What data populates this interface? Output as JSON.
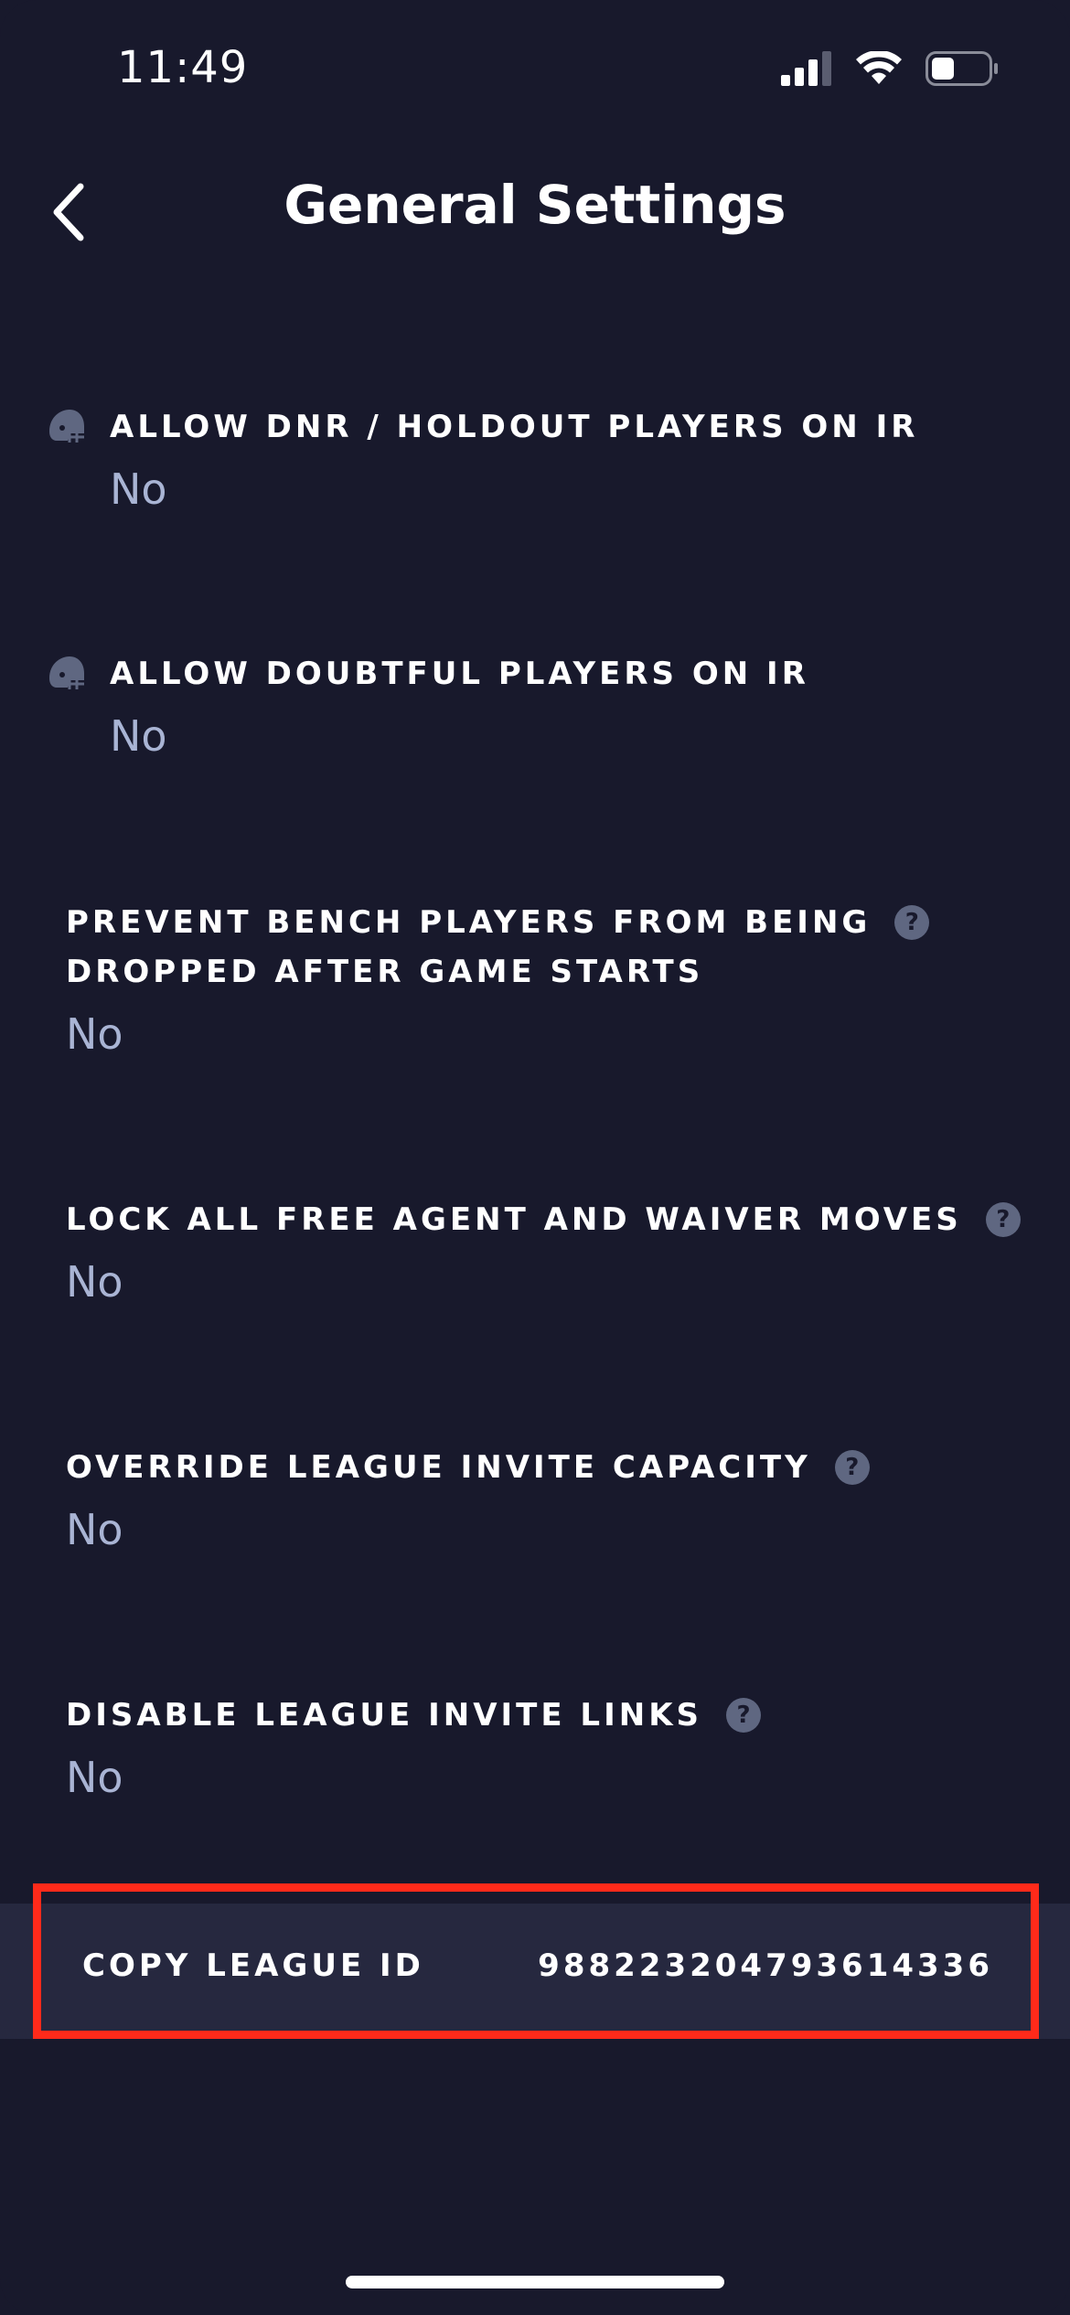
{
  "status_bar": {
    "time": "11:49"
  },
  "header": {
    "title": "General Settings",
    "back_icon": "chevron-left-icon"
  },
  "settings": [
    {
      "label": "ALLOW DNR / HOLDOUT PLAYERS ON IR",
      "value": "No",
      "icon": "football-helmet-icon"
    },
    {
      "label": "ALLOW DOUBTFUL PLAYERS ON IR",
      "value": "No",
      "icon": "football-helmet-icon"
    },
    {
      "label_line1": "PREVENT BENCH PLAYERS FROM BEING",
      "label_line2": "DROPPED AFTER GAME STARTS",
      "value": "No",
      "help": "?"
    },
    {
      "label": "LOCK ALL FREE AGENT AND WAIVER MOVES",
      "value": "No",
      "help": "?"
    },
    {
      "label": "OVERRIDE LEAGUE INVITE CAPACITY",
      "value": "No",
      "help": "?"
    },
    {
      "label": "DISABLE LEAGUE INVITE LINKS",
      "value": "No",
      "help": "?"
    }
  ],
  "copy_league": {
    "label": "COPY LEAGUE ID",
    "value": "988223204793614336"
  },
  "colors": {
    "background": "#18192c",
    "row_highlight_bg": "#26283f",
    "value_text": "#a9b4d4",
    "annotation_border": "#ff2a1a"
  }
}
